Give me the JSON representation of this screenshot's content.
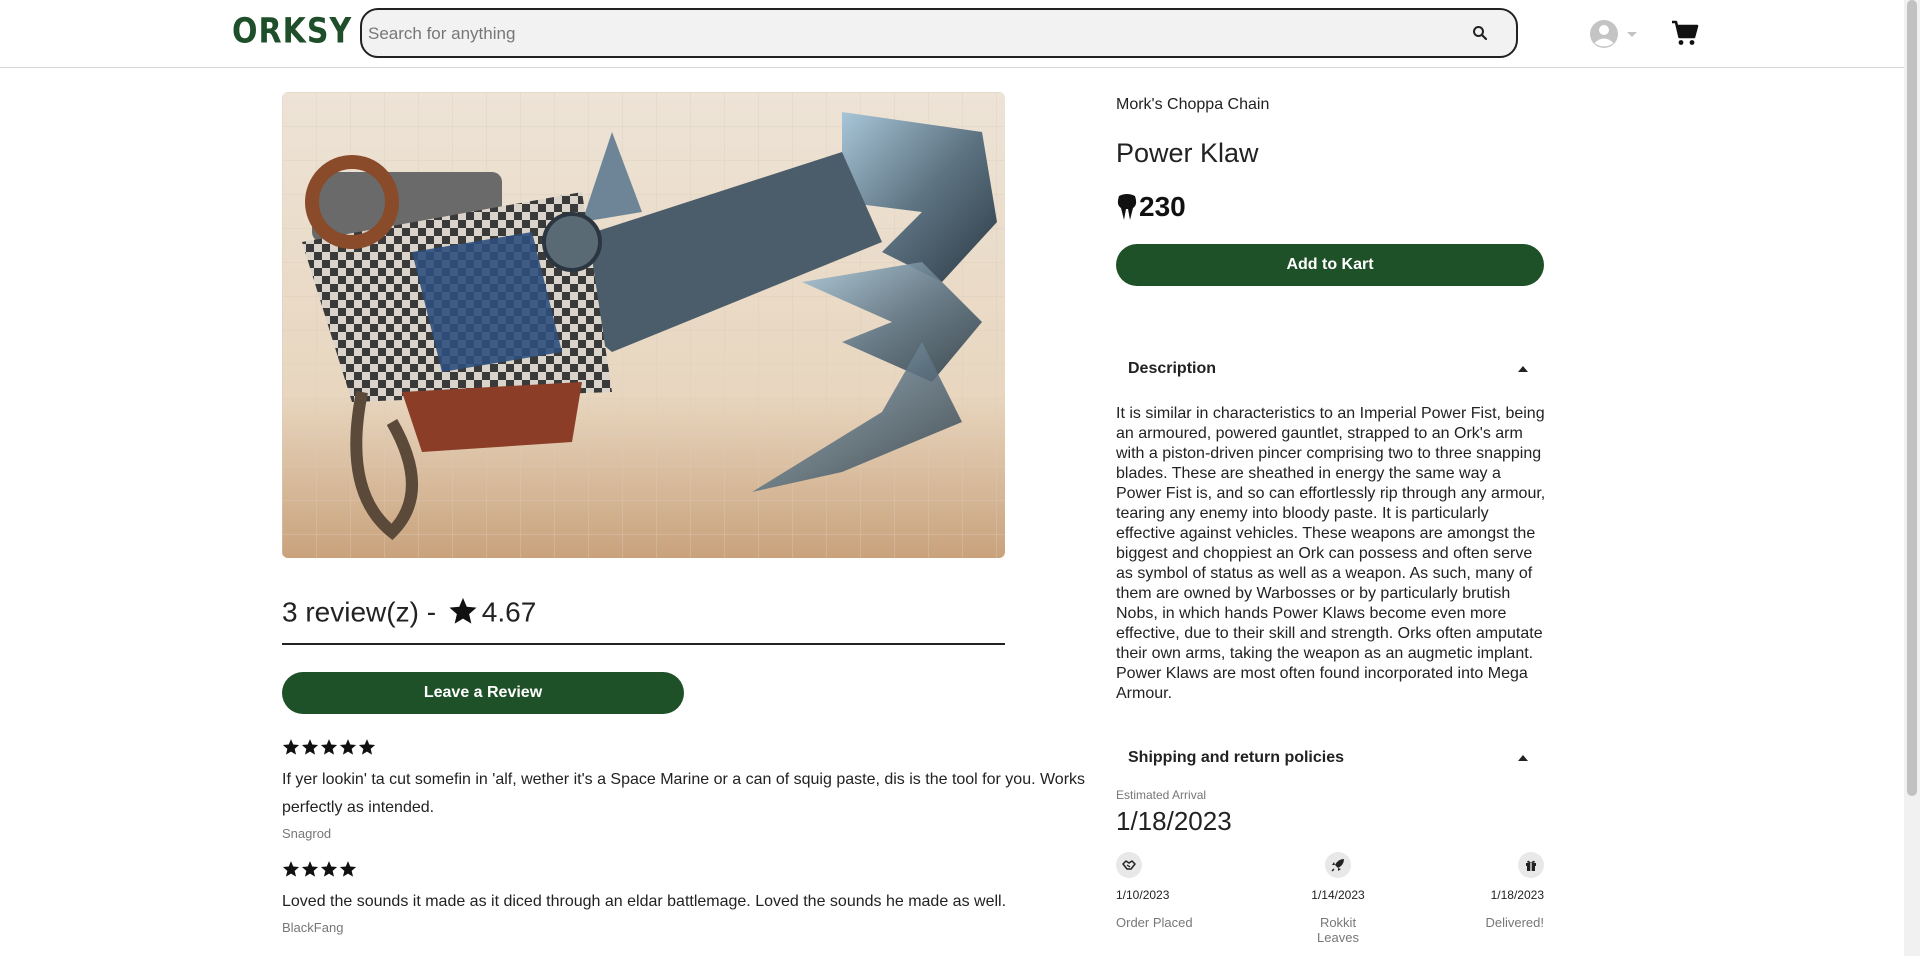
{
  "header": {
    "logo": "ORKSY",
    "search_placeholder": "Search for anything",
    "search_value": "",
    "icons": [
      "search-icon",
      "account-icon",
      "chevron-down-icon",
      "cart-icon"
    ]
  },
  "product": {
    "shop": "Mork's Choppa Chain",
    "title": "Power Klaw",
    "price": "230",
    "currency_icon": "tooth-icon",
    "add_to_cart_label": "Add to Kart"
  },
  "reviews_summary": {
    "count_text": "3 review(z) - ",
    "rating": "4.67",
    "leave_review_label": "Leave a Review"
  },
  "reviews": [
    {
      "stars": 5,
      "text": "If yer lookin' ta cut somefin in 'alf, wether it's a Space Marine or a can of squig paste, dis is the tool for you. Works perfectly as intended.",
      "author": "Snagrod"
    },
    {
      "stars": 4,
      "text": "Loved the sounds it made as it diced through an eldar battlemage. Loved the sounds he made as well.",
      "author": "BlackFang"
    }
  ],
  "description": {
    "header": "Description",
    "body": "It is similar in characteristics to an Imperial Power Fist, being an armoured, powered gauntlet, strapped to an Ork's arm with a piston-driven pincer comprising two to three snapping blades. These are sheathed in energy the same way a Power Fist is, and so can effortlessly rip through any armour, tearing any enemy into bloody paste. It is particularly effective against vehicles. These weapons are amongst the biggest and choppiest an Ork can possess and often serve as symbol of status as well as a weapon. As such, many of them are owned by Warbosses or by particularly brutish Nobs, in which hands Power Klaws become even more effective, due to their skill and strength. Orks often amputate their own arms, taking the weapon as an augmetic implant. Power Klaws are most often found incorporated into Mega Armour."
  },
  "shipping": {
    "header": "Shipping and return policies",
    "arrival_label": "Estimated Arrival",
    "arrival_date": "1/18/2023",
    "steps": [
      {
        "icon": "handshake-icon",
        "date": "1/10/2023",
        "label": "Order Placed"
      },
      {
        "icon": "rocket-icon",
        "date": "1/14/2023",
        "label": "Rokkit Leaves"
      },
      {
        "icon": "gift-icon",
        "date": "1/18/2023",
        "label": "Delivered!"
      }
    ]
  },
  "colors": {
    "brand_green": "#1f5128",
    "text": "#222222",
    "muted": "#777777"
  }
}
